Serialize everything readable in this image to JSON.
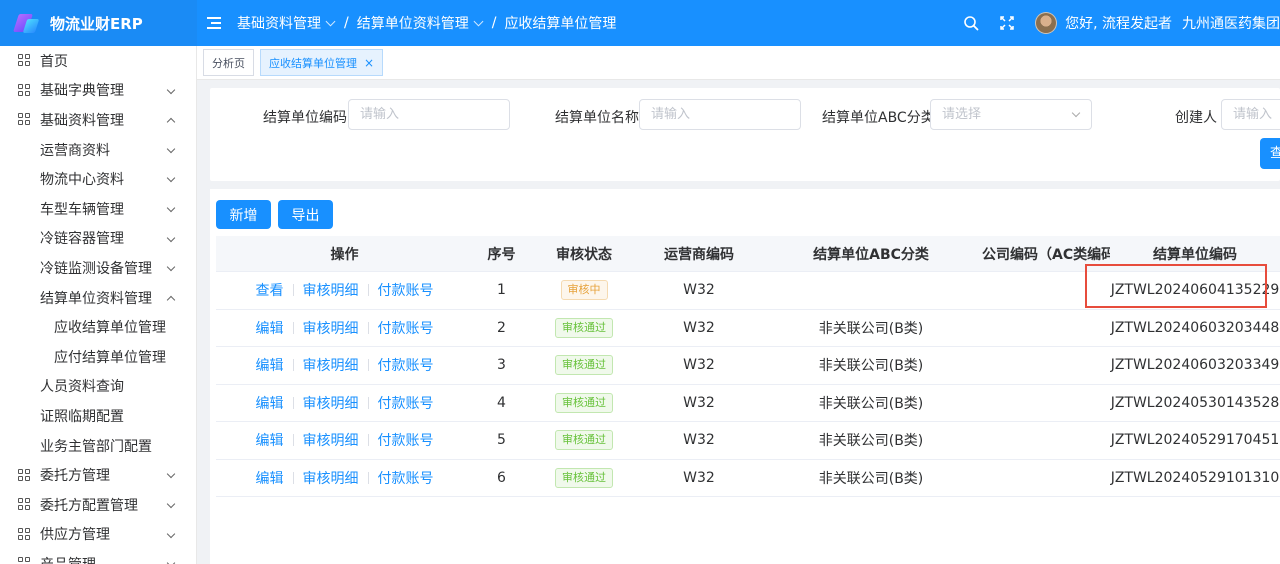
{
  "app": {
    "name": "物流业财ERP"
  },
  "breadcrumb": [
    {
      "label": "基础资料管理",
      "has_dropdown": true
    },
    {
      "label": "结算单位资料管理",
      "has_dropdown": true
    },
    {
      "label": "应收结算单位管理",
      "has_dropdown": false
    }
  ],
  "breadcrumb_sep": "/",
  "header": {
    "greeting": "您好, 流程发起者",
    "company": "九州通医药集团"
  },
  "sidebar": {
    "items": [
      {
        "label": "首页",
        "level": 1,
        "icon": "grid-icon",
        "arrow": ""
      },
      {
        "label": "基础字典管理",
        "level": 1,
        "icon": "grid-icon",
        "arrow": "down"
      },
      {
        "label": "基础资料管理",
        "level": 1,
        "icon": "grid-icon",
        "arrow": "up"
      },
      {
        "label": "运营商资料",
        "level": 2,
        "arrow": "down"
      },
      {
        "label": "物流中心资料",
        "level": 2,
        "arrow": "down"
      },
      {
        "label": "车型车辆管理",
        "level": 2,
        "arrow": "down"
      },
      {
        "label": "冷链容器管理",
        "level": 2,
        "arrow": "down"
      },
      {
        "label": "冷链监测设备管理",
        "level": 2,
        "arrow": "down"
      },
      {
        "label": "结算单位资料管理",
        "level": 2,
        "arrow": "up"
      },
      {
        "label": "应收结算单位管理",
        "level": 3,
        "arrow": ""
      },
      {
        "label": "应付结算单位管理",
        "level": 3,
        "arrow": ""
      },
      {
        "label": "人员资料查询",
        "level": 2,
        "arrow": ""
      },
      {
        "label": "证照临期配置",
        "level": 2,
        "arrow": ""
      },
      {
        "label": "业务主管部门配置",
        "level": 2,
        "arrow": ""
      },
      {
        "label": "委托方管理",
        "level": 1,
        "icon": "grid-icon",
        "arrow": "down"
      },
      {
        "label": "委托方配置管理",
        "level": 1,
        "icon": "grid-icon",
        "arrow": "down"
      },
      {
        "label": "供应方管理",
        "level": 1,
        "icon": "grid-icon",
        "arrow": "down"
      },
      {
        "label": "产品管理",
        "level": 1,
        "icon": "grid-icon",
        "arrow": "down"
      }
    ]
  },
  "tabs": [
    {
      "label": "分析页",
      "active": false,
      "closable": false
    },
    {
      "label": "应收结算单位管理",
      "active": true,
      "closable": true
    }
  ],
  "tab_close": "×",
  "filter": {
    "settle_code_label": "结算单位编码",
    "settle_code_placeholder": "请输入",
    "settle_name_label": "结算单位名称",
    "settle_name_placeholder": "请输入",
    "abc_label": "结算单位ABC分类",
    "abc_placeholder": "请选择",
    "creator_label": "创建人",
    "creator_placeholder": "请输入",
    "query_label": "查询"
  },
  "toolbar": {
    "add_label": "新增",
    "export_label": "导出"
  },
  "table": {
    "headers": [
      "操作",
      "序号",
      "审核状态",
      "运营商编码",
      "结算单位ABC分类",
      "公司编码（AC类编码）",
      "结算单位编码"
    ],
    "rows": [
      {
        "ops": [
          "查看",
          "审核明细",
          "付款账号"
        ],
        "no": "1",
        "status": "审核中",
        "status_type": "pending",
        "carrier": "W32",
        "abc": "",
        "company": "",
        "code": "JZTWL20240604135229"
      },
      {
        "ops": [
          "编辑",
          "审核明细",
          "付款账号"
        ],
        "no": "2",
        "status": "审核通过",
        "status_type": "pass",
        "carrier": "W32",
        "abc": "非关联公司(B类)",
        "company": "",
        "code": "JZTWL20240603203448"
      },
      {
        "ops": [
          "编辑",
          "审核明细",
          "付款账号"
        ],
        "no": "3",
        "status": "审核通过",
        "status_type": "pass",
        "carrier": "W32",
        "abc": "非关联公司(B类)",
        "company": "",
        "code": "JZTWL20240603203349"
      },
      {
        "ops": [
          "编辑",
          "审核明细",
          "付款账号"
        ],
        "no": "4",
        "status": "审核通过",
        "status_type": "pass",
        "carrier": "W32",
        "abc": "非关联公司(B类)",
        "company": "",
        "code": "JZTWL20240530143528"
      },
      {
        "ops": [
          "编辑",
          "审核明细",
          "付款账号"
        ],
        "no": "5",
        "status": "审核通过",
        "status_type": "pass",
        "carrier": "W32",
        "abc": "非关联公司(B类)",
        "company": "",
        "code": "JZTWL20240529170451"
      },
      {
        "ops": [
          "编辑",
          "审核明细",
          "付款账号"
        ],
        "no": "6",
        "status": "审核通过",
        "status_type": "pass",
        "carrier": "W32",
        "abc": "非关联公司(B类)",
        "company": "",
        "code": "JZTWL20240529101310"
      }
    ]
  },
  "colors": {
    "primary": "#1890ff",
    "pending": "#e6a23c",
    "pass": "#67c23a",
    "highlight": "#e74c3c"
  }
}
